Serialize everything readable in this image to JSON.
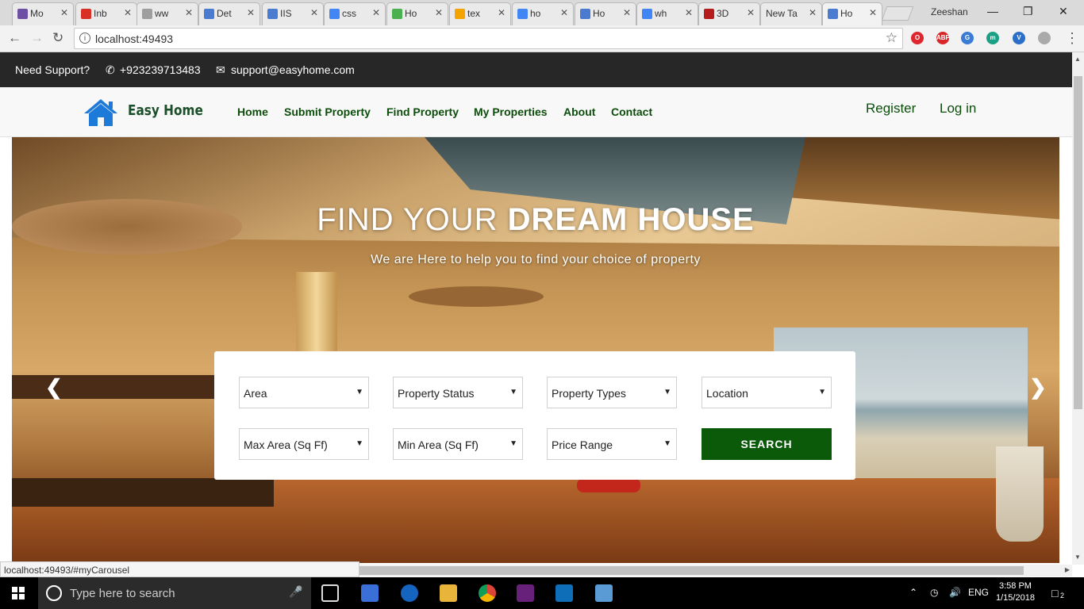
{
  "browser": {
    "tabs": [
      {
        "label": "Mo",
        "color": "#6d4fa3",
        "active": false
      },
      {
        "label": "Inb",
        "color": "#d93025",
        "active": false
      },
      {
        "label": "ww",
        "color": "#9e9e9e",
        "active": false
      },
      {
        "label": "Det",
        "color": "#4a7bd1",
        "active": false
      },
      {
        "label": "IIS",
        "color": "#4a7bd1",
        "active": false
      },
      {
        "label": "css",
        "color": "#4285f4",
        "active": false
      },
      {
        "label": "Ho",
        "color": "#4caf50",
        "active": false
      },
      {
        "label": "tex",
        "color": "#f4a300",
        "active": false
      },
      {
        "label": "ho",
        "color": "#4285f4",
        "active": false
      },
      {
        "label": "Ho",
        "color": "#4a7bd1",
        "active": false
      },
      {
        "label": "wh",
        "color": "#4285f4",
        "active": false
      },
      {
        "label": "3D",
        "color": "#b71c1c",
        "active": false
      },
      {
        "label": "New Ta",
        "color": "",
        "active": false
      },
      {
        "label": "Ho",
        "color": "#4a7bd1",
        "active": true
      }
    ],
    "profile_name": "Zeeshan",
    "url": "localhost:49493",
    "status_url": "localhost:49493/#myCarousel",
    "extensions": [
      {
        "name": "opera-icon",
        "color": "#e0262d",
        "text": "O"
      },
      {
        "name": "adblock-icon",
        "color": "#d9262a",
        "text": "ABP"
      },
      {
        "name": "extension-icon",
        "color": "#3a7bd5",
        "text": "G"
      },
      {
        "name": "m-extension-icon",
        "color": "#1aa085",
        "text": "m"
      },
      {
        "name": "shield-extension-icon",
        "color": "#2a6ec7",
        "text": "V"
      },
      {
        "name": "cast-icon",
        "color": "#aaaaaa",
        "text": ""
      }
    ]
  },
  "support": {
    "label": "Need Support?",
    "phone": "+923239713483",
    "email": "support@easyhome.com"
  },
  "brand": {
    "name": "Easy Home",
    "accent": "#0c4d0c",
    "icon_color": "#1e7ad9"
  },
  "nav": {
    "items": [
      "Home",
      "Submit Property",
      "Find Property",
      "My Properties",
      "About",
      "Contact"
    ],
    "register": "Register",
    "login": "Log in"
  },
  "hero": {
    "title_light": "FIND YOUR ",
    "title_bold": "DREAM HOUSE",
    "subtitle": "We are Here to help you to find your choice of property",
    "prev_icon": "chevron-left-icon",
    "next_icon": "chevron-right-icon"
  },
  "search": {
    "row1": [
      "Area",
      "Property Status",
      "Property Types",
      "Location"
    ],
    "row2": [
      "Max Area (Sq Ff)",
      "Min Area (Sq Ff)",
      "Price Range"
    ],
    "button": "SEARCH",
    "button_color": "#0a5a0a"
  },
  "taskbar": {
    "search_placeholder": "Type here to search",
    "language": "ENG",
    "time": "3:58 PM",
    "date": "1/15/2018",
    "notifications": "2"
  }
}
